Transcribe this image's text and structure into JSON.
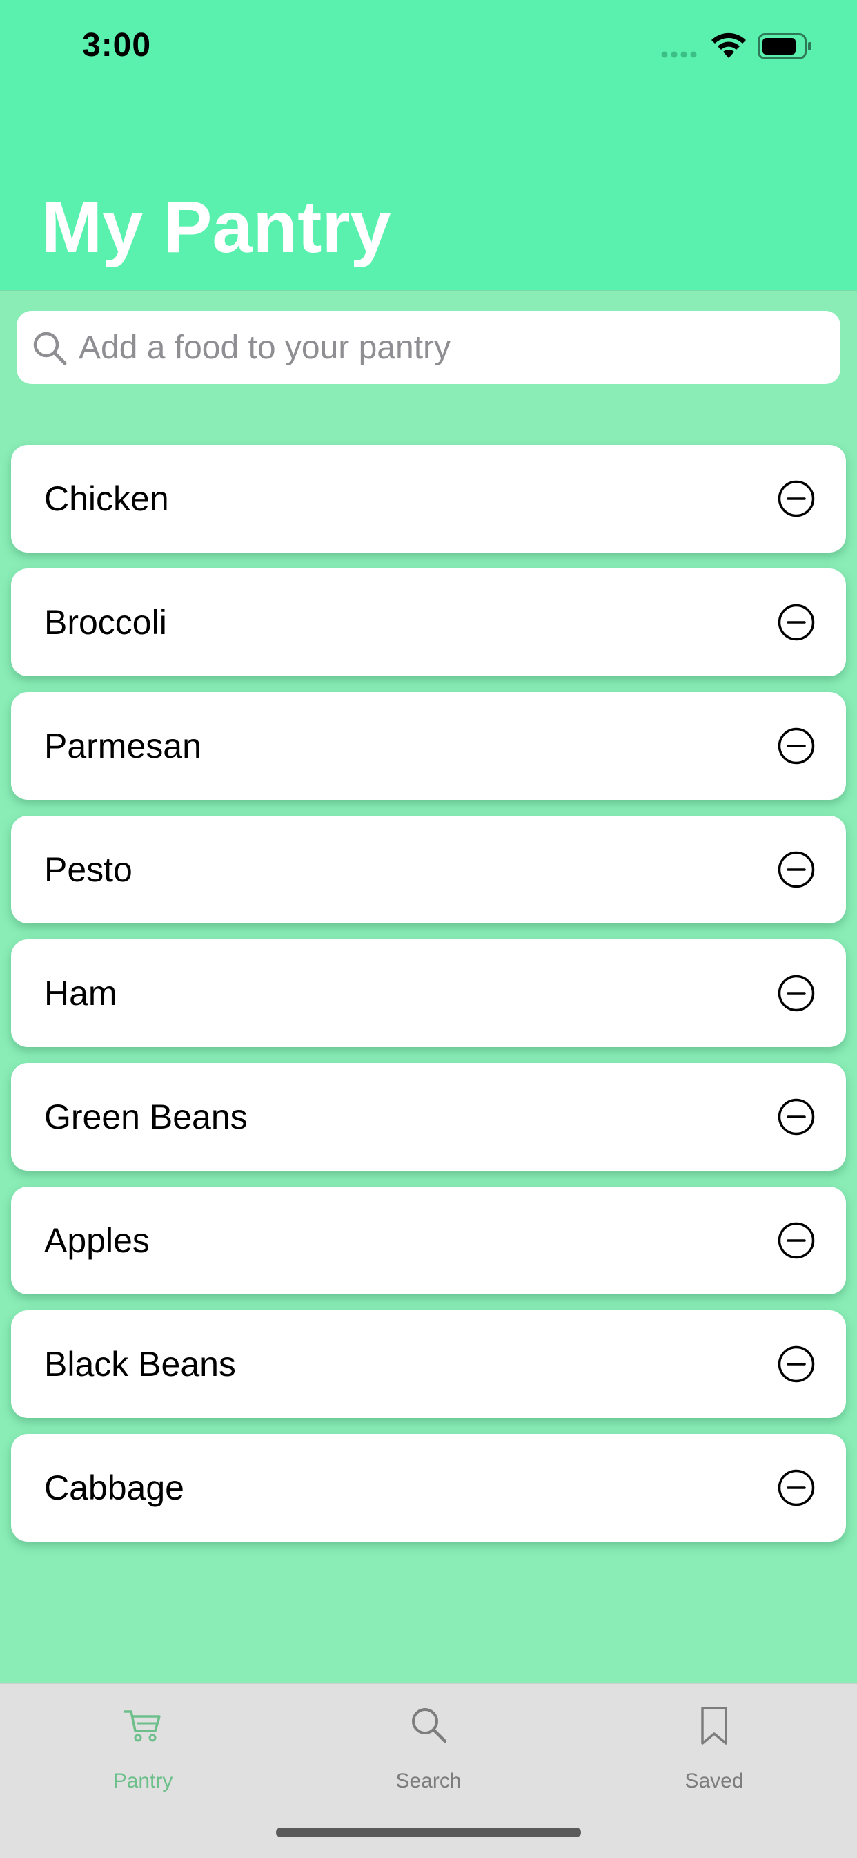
{
  "status_bar": {
    "time": "3:00"
  },
  "header": {
    "title": "My Pantry"
  },
  "search": {
    "placeholder": "Add a food to your pantry",
    "value": ""
  },
  "pantry": {
    "items": [
      {
        "label": "Chicken"
      },
      {
        "label": "Broccoli"
      },
      {
        "label": "Parmesan"
      },
      {
        "label": "Pesto"
      },
      {
        "label": "Ham"
      },
      {
        "label": "Green Beans"
      },
      {
        "label": "Apples"
      },
      {
        "label": "Black Beans"
      },
      {
        "label": "Cabbage"
      }
    ],
    "remove_icon": "minus-circle-icon"
  },
  "tab_bar": {
    "tabs": [
      {
        "label": "Pantry",
        "icon": "cart-icon",
        "active": true
      },
      {
        "label": "Search",
        "icon": "search-icon",
        "active": false
      },
      {
        "label": "Saved",
        "icon": "bookmark-icon",
        "active": false
      }
    ]
  },
  "colors": {
    "header_background": "#5af1af",
    "content_background": "#8aedb6",
    "active_tab": "#6cbf8a",
    "inactive_tab": "#7d7d7d"
  }
}
